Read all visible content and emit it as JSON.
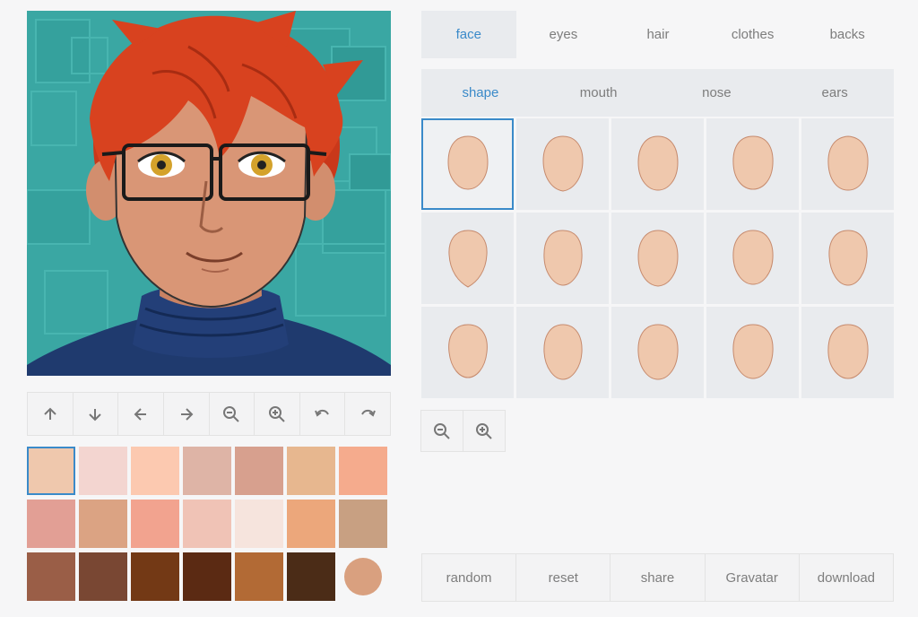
{
  "tabs": [
    {
      "label": "face",
      "active": true
    },
    {
      "label": "eyes",
      "active": false
    },
    {
      "label": "hair",
      "active": false
    },
    {
      "label": "clothes",
      "active": false
    },
    {
      "label": "backs",
      "active": false
    }
  ],
  "subtabs": [
    {
      "label": "shape",
      "active": true
    },
    {
      "label": "mouth",
      "active": false
    },
    {
      "label": "nose",
      "active": false
    },
    {
      "label": "ears",
      "active": false
    }
  ],
  "controls": [
    {
      "icon": "arrow-up-icon"
    },
    {
      "icon": "arrow-down-icon"
    },
    {
      "icon": "arrow-left-icon"
    },
    {
      "icon": "arrow-right-icon"
    },
    {
      "icon": "zoom-out-icon"
    },
    {
      "icon": "zoom-in-icon"
    },
    {
      "icon": "rotate-left-icon"
    },
    {
      "icon": "rotate-right-icon"
    }
  ],
  "palette": {
    "selected_index": 0,
    "colors": [
      "#efc8ad",
      "#f3d5d0",
      "#fcc9b0",
      "#deb4a6",
      "#d7a08e",
      "#e7b78f",
      "#f5ab8d",
      "#e29f95",
      "#dba383",
      "#f2a38f",
      "#f0c3b6",
      "#f6e4dd",
      "#eca77b",
      "#c8a082",
      "#9a5e47",
      "#794733",
      "#733915",
      "#5b2a13",
      "#b26a35",
      "#4b2c17",
      "#d9a07f"
    ],
    "round_index": 20
  },
  "face_shapes": {
    "selected_index": 0,
    "count": 15,
    "fill": "#efc8ad",
    "stroke": "#c68a6d"
  },
  "zoom": [
    {
      "icon": "zoom-out-icon"
    },
    {
      "icon": "zoom-in-icon"
    }
  ],
  "actions": [
    {
      "label": "random"
    },
    {
      "label": "reset"
    },
    {
      "label": "share"
    },
    {
      "label": "Gravatar"
    },
    {
      "label": "download"
    }
  ],
  "colors": {
    "accent": "#3a8ac9",
    "background_teal": "#3aa7a3",
    "hair": "#d8421f",
    "sweater": "#1f3a6e"
  }
}
